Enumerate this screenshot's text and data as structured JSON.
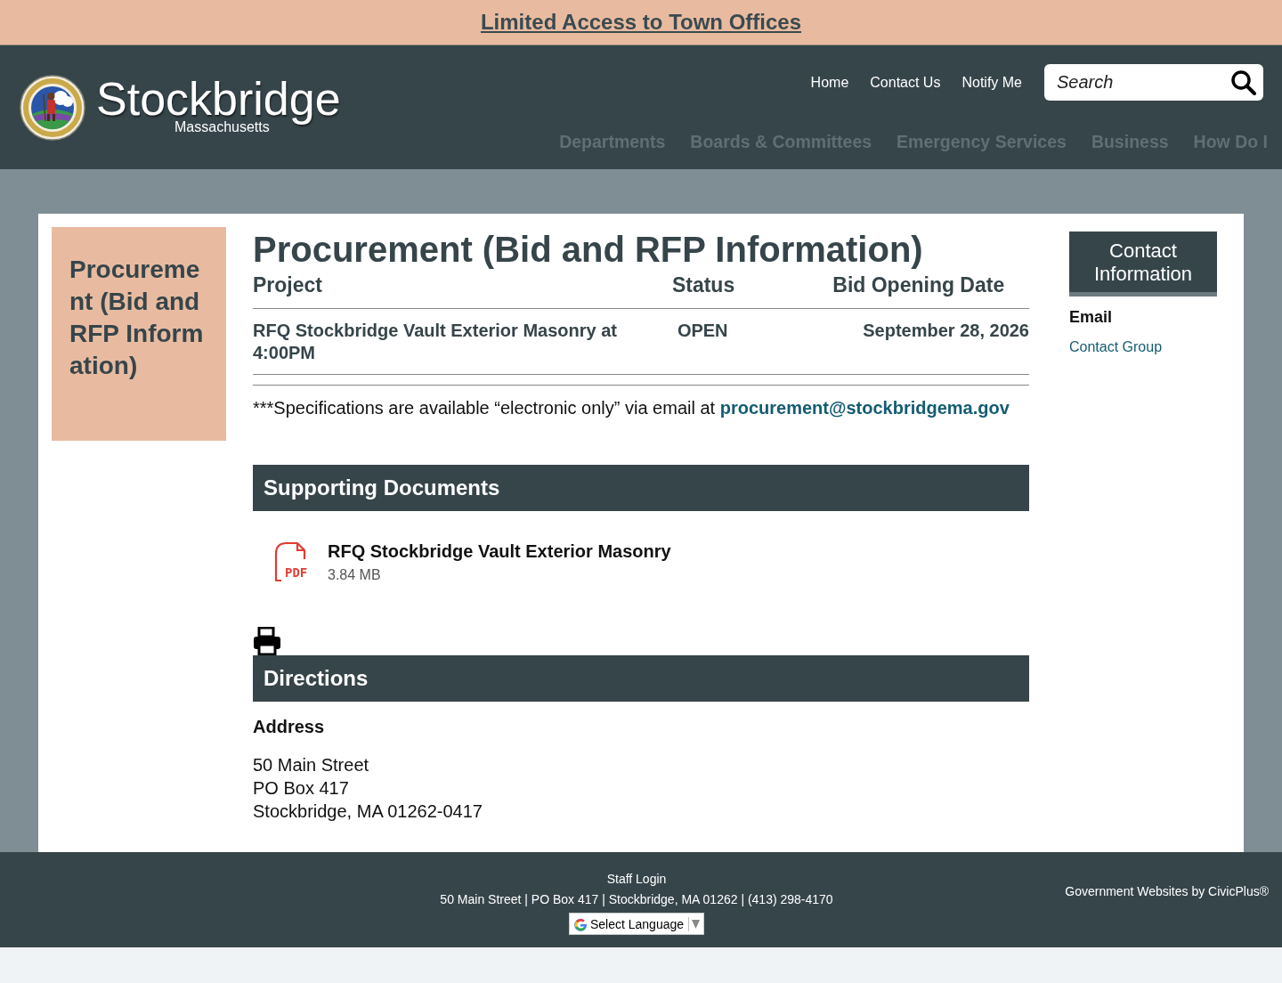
{
  "alert": {
    "text": "Limited Access to Town Offices"
  },
  "header": {
    "site_name": "Stockbridge",
    "site_subtitle": "Massachusetts",
    "utility_links": [
      "Home",
      "Contact Us",
      "Notify Me"
    ],
    "search": {
      "placeholder": "Search"
    },
    "nav": [
      "Departments",
      "Boards & Committees",
      "Emergency Services",
      "Business",
      "How Do I"
    ]
  },
  "sidebar": {
    "title": "Procurement (Bid and RFP Information)"
  },
  "content": {
    "title": "Procurement (Bid and RFP Information)",
    "table": {
      "columns": [
        "Project",
        "Status",
        "Bid Opening Date"
      ],
      "rows": [
        {
          "project": "RFQ Stockbridge Vault Exterior Masonry at 4:00PM",
          "status": "OPEN",
          "date": "September 28, 2026"
        }
      ]
    },
    "note": {
      "text": "***Specifications are available “electronic only” via email at ",
      "link": "procurement@stockbridgema.gov"
    },
    "documents": {
      "heading": "Supporting Documents",
      "items": [
        {
          "name": "RFQ Stockbridge Vault Exterior Masonry",
          "size": "3.84 MB",
          "file_type": "PDF"
        }
      ]
    },
    "directions": {
      "heading": "Directions",
      "address_label": "Address",
      "address_lines": [
        "50 Main Street",
        "PO Box 417",
        "Stockbridge, MA 01262-0417"
      ]
    }
  },
  "contact": {
    "heading": "Contact Information",
    "label": "Email",
    "link": "Contact Group"
  },
  "footer": {
    "staff_login": "Staff Login",
    "address": "50 Main Street | PO Box 417 | Stockbridge, MA 01262 | (413) 298-4170",
    "language": "Select Language",
    "credit": "Government Websites by CivicPlus®"
  }
}
